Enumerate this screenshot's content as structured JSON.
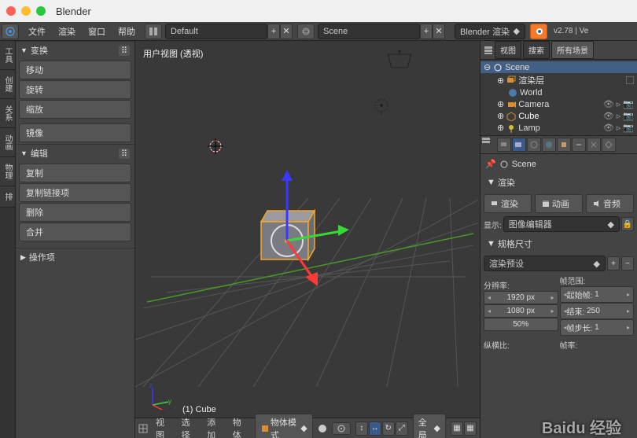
{
  "title": "Blender",
  "menubar": {
    "file": "文件",
    "render": "渲染",
    "window": "窗口",
    "help": "帮助"
  },
  "layout_name": "Default",
  "scene_name": "Scene",
  "engine": "Blender 渲染",
  "version": "v2.78 | Ve",
  "vtabs": [
    "工具",
    "创建",
    "关系",
    "动画",
    "物理",
    "排"
  ],
  "left": {
    "transform": {
      "title": "变换",
      "move": "移动",
      "rotate": "旋转",
      "scale": "缩放",
      "mirror": "镜像"
    },
    "edit": {
      "title": "编辑",
      "dup": "复制",
      "duplink": "复制链接项",
      "del": "删除",
      "join": "合并"
    },
    "ops": {
      "title": "操作项"
    }
  },
  "viewport": {
    "label": "用户视图 (透视)",
    "object": "(1) Cube",
    "footer": {
      "view": "视图",
      "select": "选择",
      "add": "添加",
      "object": "物体",
      "mode": "物体模式",
      "global": "全局"
    }
  },
  "outliner": {
    "tabs": {
      "view": "视图",
      "search": "搜索",
      "all": "所有场景"
    },
    "scene": "Scene",
    "renderlayers": "渲染层",
    "world": "World",
    "camera": "Camera",
    "cube": "Cube",
    "lamp": "Lamp"
  },
  "props": {
    "scene_bc": "Scene",
    "render_section": "渲染",
    "render_btn": "渲染",
    "anim_btn": "动画",
    "audio_btn": "音频",
    "display": "显示:",
    "image_editor": "图像编辑器",
    "dimensions": "规格尺寸",
    "preset": "渲染预设",
    "res_label": "分辨率:",
    "frame_label": "帧范围:",
    "resx": "1920 px",
    "resy": "1080 px",
    "pct": "50%",
    "start_l": "起始帧:",
    "end_l": "结束:",
    "step_l": "帧步长:",
    "start": "1",
    "end": "250",
    "step": "1",
    "aspect": "纵横比:",
    "fps": "帧率:"
  }
}
